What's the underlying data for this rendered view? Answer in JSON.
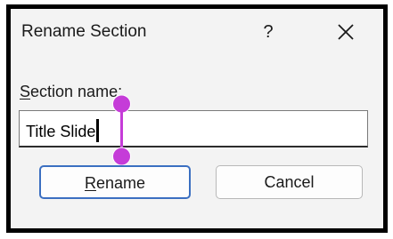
{
  "dialog": {
    "title": "Rename Section",
    "help_label": "?",
    "close_icon": "close-icon"
  },
  "field": {
    "label_first": "S",
    "label_rest": "ection name:",
    "value": "Title Slide"
  },
  "buttons": {
    "rename_first": "R",
    "rename_rest": "ename",
    "cancel": "Cancel"
  },
  "colors": {
    "accent": "#3b6fc1",
    "selection_handle": "#c53cd8",
    "dialog_bg": "#f3f3f3"
  }
}
